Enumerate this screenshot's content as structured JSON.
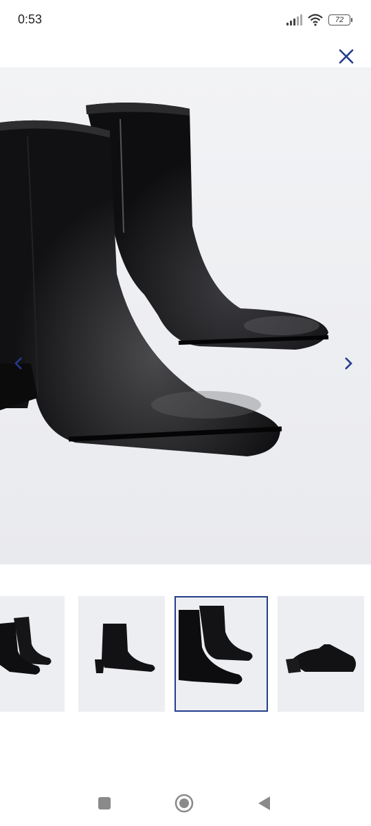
{
  "status_bar": {
    "time": "0:53",
    "battery_level": "72",
    "icons": [
      "signal-icon",
      "wifi-icon",
      "battery-icon"
    ]
  },
  "header": {
    "close_icon": "close-icon"
  },
  "viewer": {
    "image": "black-ankle-boots-closeup",
    "prev_icon": "chevron-left-icon",
    "next_icon": "chevron-right-icon"
  },
  "thumbnails": [
    {
      "image": "boots-pair-side",
      "selected": false
    },
    {
      "image": "single-boot-side",
      "selected": false
    },
    {
      "image": "boots-closeup",
      "selected": true
    },
    {
      "image": "boot-sole",
      "selected": false
    }
  ],
  "colors": {
    "accent": "#233c8c",
    "viewer_bg": "#eff0f3",
    "thumb_bg": "#eceef1",
    "nav_icon": "#8a8a8a"
  },
  "navigation_bar": {
    "recent_icon": "recent-apps-icon",
    "home_icon": "home-icon",
    "back_icon": "back-icon"
  }
}
